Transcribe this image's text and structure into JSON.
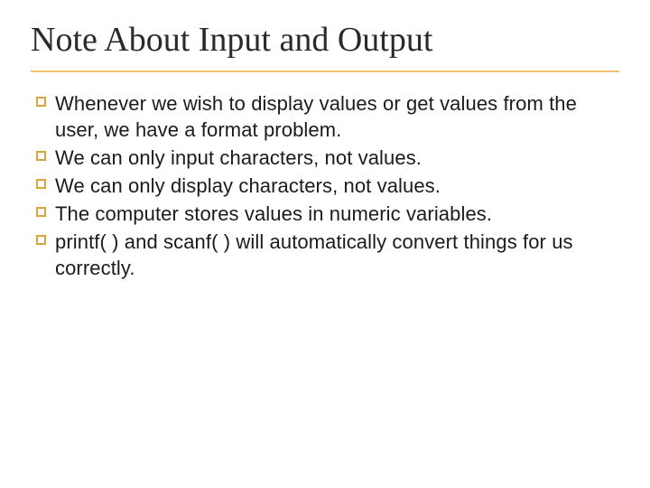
{
  "title": "Note About Input and Output",
  "bullets": [
    "Whenever we wish to display values or get values from the user, we have a format problem.",
    "We can only input characters, not values.",
    "We can only display characters, not values.",
    "The computer stores values in numeric variables.",
    "printf( ) and scanf( ) will automatically convert things for us correctly."
  ]
}
